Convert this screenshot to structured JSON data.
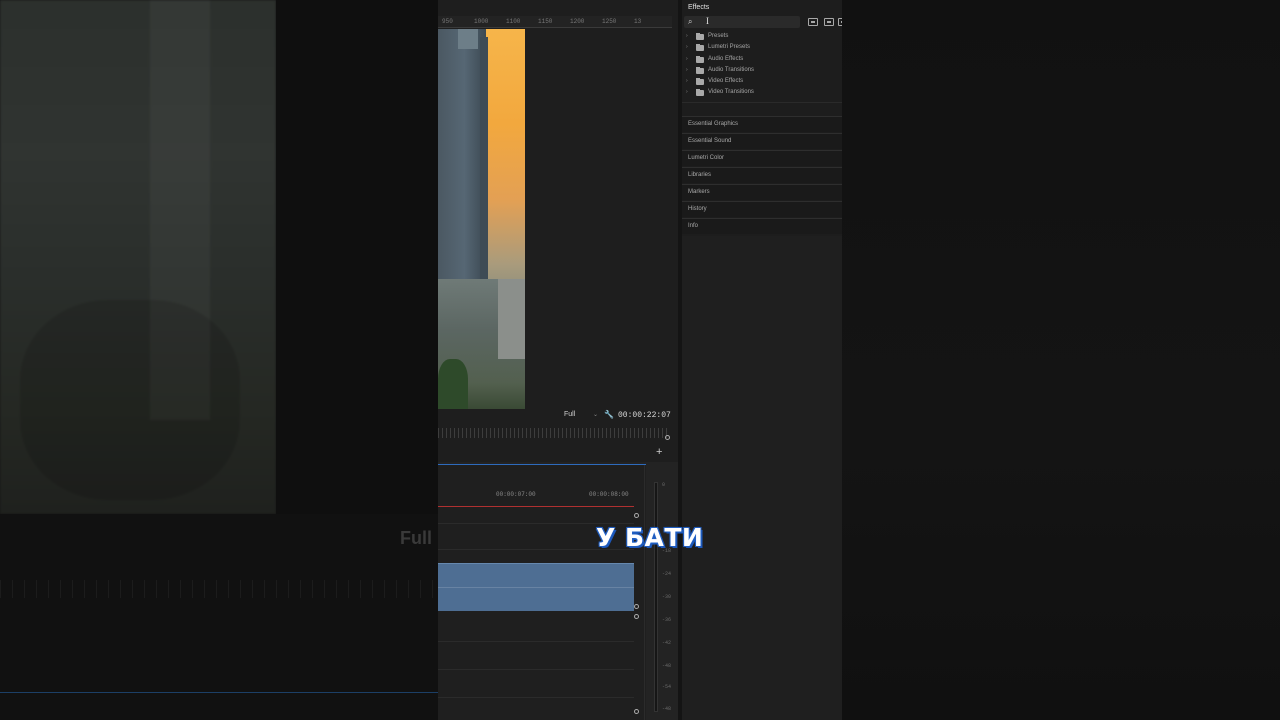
{
  "monitor": {
    "ruler_ticks": [
      "950",
      "1000",
      "1100",
      "1150",
      "1200",
      "1250",
      "13"
    ],
    "resolution": "Full",
    "timecode": "00:00:22:07",
    "add_label": "+"
  },
  "timeline": {
    "timecodes": [
      "00:00:07:00",
      "00:00:08:00"
    ]
  },
  "meter": {
    "ticks": [
      "0",
      "-18",
      "-24",
      "-30",
      "-36",
      "-42",
      "-48",
      "-54",
      "-48"
    ]
  },
  "effects": {
    "title": "Effects",
    "tree": [
      {
        "label": "Presets"
      },
      {
        "label": "Lumetri Presets"
      },
      {
        "label": "Audio Effects"
      },
      {
        "label": "Audio Transitions"
      },
      {
        "label": "Video Effects"
      },
      {
        "label": "Video Transitions"
      }
    ],
    "panels": [
      {
        "label": "Essential Graphics"
      },
      {
        "label": "Essential Sound"
      },
      {
        "label": "Lumetri Color"
      },
      {
        "label": "Libraries"
      },
      {
        "label": "Markers"
      },
      {
        "label": "History"
      },
      {
        "label": "Info"
      }
    ]
  },
  "background": {
    "full_label": "Full"
  },
  "caption": "У БАТИ",
  "colors": {
    "caption_outline": "#1d57b8",
    "clip": "#4e6e93",
    "playhead": "#b03030",
    "accent": "#2e6bbd"
  }
}
